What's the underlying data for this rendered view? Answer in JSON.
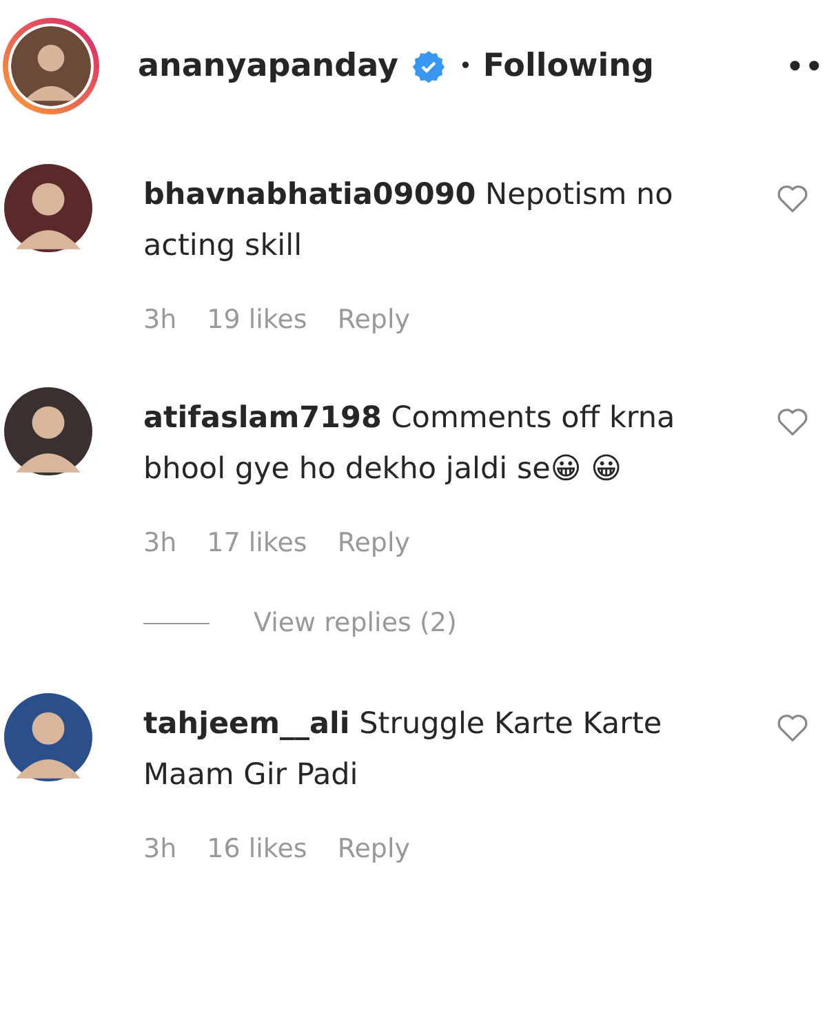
{
  "header": {
    "username": "ananyapanday",
    "verified": true,
    "separator": "•",
    "follow_label": "Following",
    "more": "••"
  },
  "comments": [
    {
      "username": "bhavnabhatia09090",
      "text": "Nepotism no acting skill",
      "time": "3h",
      "likes": "19 likes",
      "reply": "Reply"
    },
    {
      "username": "atifaslam7198",
      "text": "Comments off krna bhool gye ho dekho jaldi se😀 😀",
      "time": "3h",
      "likes": "17 likes",
      "reply": "Reply",
      "replies_link": "View replies (2)"
    },
    {
      "username": "tahjeem__ali",
      "text": "Struggle Karte Karte Maam Gir Padi",
      "time": "3h",
      "likes": "16 likes",
      "reply": "Reply"
    }
  ]
}
